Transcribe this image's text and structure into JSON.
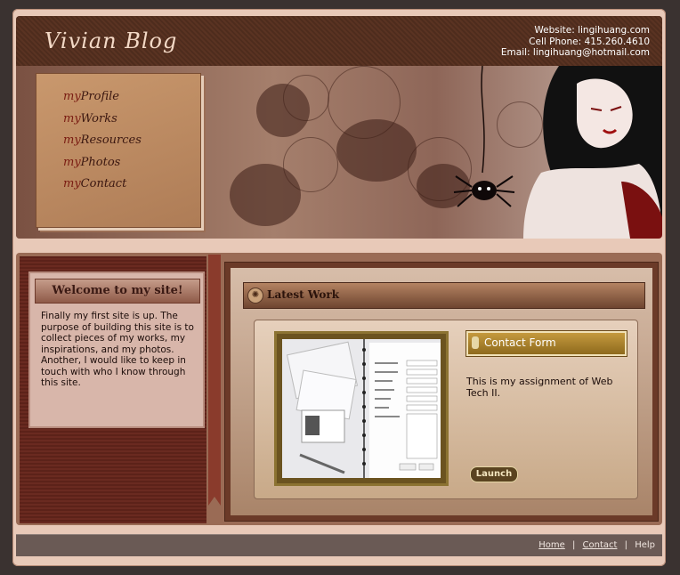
{
  "header": {
    "logo": "Vivian Blog",
    "website": "Website: lingihuang.com",
    "phone": "Cell Phone: 415.260.4610",
    "email": "Email: lingihuang@hotmail.com"
  },
  "nav": {
    "items": [
      {
        "prefix": "my",
        "label": "Profile"
      },
      {
        "prefix": "my",
        "label": "Works"
      },
      {
        "prefix": "my",
        "label": "Resources"
      },
      {
        "prefix": "my",
        "label": "Photos"
      },
      {
        "prefix": "my",
        "label": "Contact"
      }
    ]
  },
  "welcome": {
    "title": "Welcome to my site!",
    "text": "Finally my first site is up. The purpose of building this site is to collect pieces of my works, my inspirations, and my photos. Another, I would like to keep in touch with who I know through this site."
  },
  "latest": {
    "title": "Latest Work",
    "item_title": "Contact Form",
    "description": "This is my assignment of Web Tech II.",
    "button": "Launch"
  },
  "footer": {
    "home": "Home",
    "contact": "Contact",
    "help": "Help",
    "separator": "|"
  },
  "colors": {
    "header_bar": "#4e2c1d",
    "nav_card": "#c9986d",
    "left_column": "#5c2219",
    "accent_gold": "#c59a3e"
  }
}
